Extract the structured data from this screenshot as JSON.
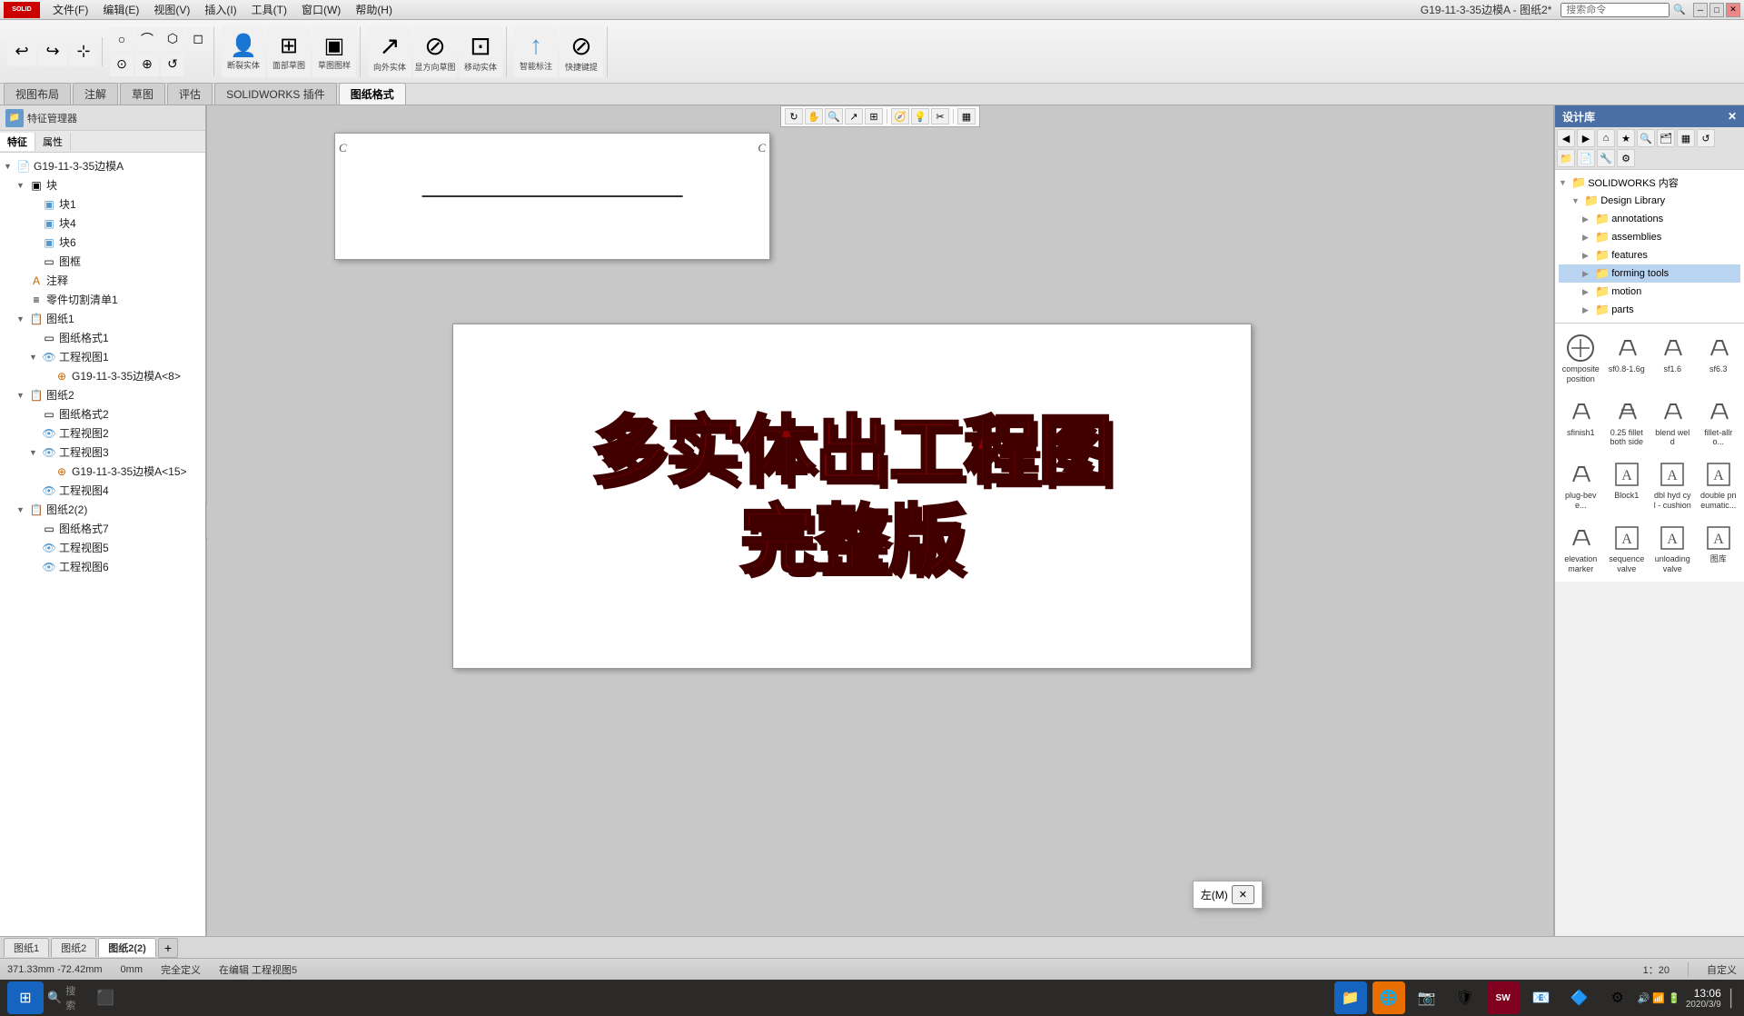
{
  "app": {
    "title": "G19-11-3-35边模A - 图纸2*",
    "logo_text": "SW"
  },
  "menubar": {
    "items": [
      "文件(F)",
      "编辑(E)",
      "视图(V)",
      "插入(I)",
      "工具(T)",
      "窗口(W)",
      "帮助(H)"
    ],
    "search_placeholder": "搜索命令"
  },
  "toolbar": {
    "groups": [
      {
        "buttons": [
          "↩",
          "↪",
          "⊕"
        ]
      },
      {
        "buttons": [
          "○",
          "⊙",
          "⌒",
          "◇",
          "○",
          "⊙",
          "↺"
        ]
      },
      {
        "large_buttons": [
          {
            "icon": "👤",
            "label": "断裂实体"
          },
          {
            "icon": "⬡",
            "label": "面部草图"
          },
          {
            "icon": "▣",
            "label": "草图图样"
          }
        ]
      },
      {
        "large_buttons": [
          {
            "icon": "↗",
            "label": "向外实体"
          },
          {
            "icon": "⊞",
            "label": "显方向草图"
          },
          {
            "icon": "⊡",
            "label": "移动实体"
          }
        ]
      },
      {
        "large_buttons": [
          {
            "icon": "⬆",
            "label": "智能标注"
          },
          {
            "icon": "⊘",
            "label": "快捷键提"
          }
        ]
      }
    ]
  },
  "tabs": {
    "items": [
      "视图布局",
      "注解",
      "草图",
      "评估",
      "SOLIDWORKS 插件",
      "图纸格式"
    ]
  },
  "left_panel": {
    "title": "G19-11-3-35边模A",
    "tree": [
      {
        "id": "root",
        "label": "G19-11-3-35边模A",
        "level": 0,
        "expanded": true,
        "icon": "📄"
      },
      {
        "id": "block",
        "label": "块",
        "level": 1,
        "expanded": true,
        "icon": "▣"
      },
      {
        "id": "block1",
        "label": "块1",
        "level": 2,
        "icon": "▣"
      },
      {
        "id": "block4",
        "label": "块4",
        "level": 2,
        "icon": "▣"
      },
      {
        "id": "block6",
        "label": "块6",
        "level": 2,
        "icon": "▣"
      },
      {
        "id": "frame",
        "label": "图框",
        "level": 2,
        "icon": "▭"
      },
      {
        "id": "note",
        "label": "注释",
        "level": 1,
        "icon": "A"
      },
      {
        "id": "bom",
        "label": "零件切割清单1",
        "level": 1,
        "icon": "≡"
      },
      {
        "id": "sheet1",
        "label": "图纸1",
        "level": 1,
        "expanded": true,
        "icon": "📋"
      },
      {
        "id": "view-style1",
        "label": "图纸格式1",
        "level": 2,
        "icon": "▭"
      },
      {
        "id": "view1",
        "label": "工程视图1",
        "level": 2,
        "expanded": true,
        "icon": "👁"
      },
      {
        "id": "view1-ref",
        "label": "G19-11-3-35边模A<8>",
        "level": 3,
        "icon": "⊕"
      },
      {
        "id": "sheet2",
        "label": "图纸2",
        "level": 1,
        "expanded": true,
        "icon": "📋"
      },
      {
        "id": "view-style2",
        "label": "图纸格式2",
        "level": 2,
        "icon": "▭"
      },
      {
        "id": "view2",
        "label": "工程视图2",
        "level": 2,
        "icon": "👁"
      },
      {
        "id": "view3",
        "label": "工程视图3",
        "level": 2,
        "expanded": true,
        "icon": "👁"
      },
      {
        "id": "view3-ref",
        "label": "G19-11-3-35边模A<15>",
        "level": 3,
        "icon": "⊕"
      },
      {
        "id": "view4",
        "label": "工程视图4",
        "level": 2,
        "icon": "👁"
      },
      {
        "id": "sheet2b",
        "label": "图纸2(2)",
        "level": 1,
        "expanded": true,
        "icon": "📋"
      },
      {
        "id": "view-style7",
        "label": "图纸格式7",
        "level": 2,
        "icon": "▭"
      },
      {
        "id": "view5",
        "label": "工程视图5",
        "level": 2,
        "icon": "👁"
      },
      {
        "id": "view6",
        "label": "工程视图6",
        "level": 2,
        "icon": "👁"
      }
    ]
  },
  "drawing_area": {
    "main_text_line1": "多实体出工程图",
    "main_text_line2": "完整版",
    "corner_marks": [
      "C",
      "C"
    ]
  },
  "right_panel": {
    "title": "设计库",
    "nav_buttons": [
      "◀",
      "▶",
      "⌂",
      "★",
      "🔍",
      "🖹",
      "▦",
      "↺"
    ],
    "tree": [
      {
        "id": "sw-content",
        "label": "SOLIDWORKS 内容",
        "level": 0,
        "expanded": true,
        "icon": "folder"
      },
      {
        "id": "design-lib",
        "label": "Design Library",
        "level": 1,
        "expanded": true,
        "icon": "folder"
      },
      {
        "id": "annotations",
        "label": "annotations",
        "level": 2,
        "expanded": false,
        "icon": "folder"
      },
      {
        "id": "assemblies",
        "label": "assemblies",
        "level": 2,
        "expanded": false,
        "icon": "folder"
      },
      {
        "id": "features",
        "label": "features",
        "level": 2,
        "expanded": false,
        "icon": "folder"
      },
      {
        "id": "forming-tools",
        "label": "forming tools",
        "level": 2,
        "expanded": false,
        "icon": "folder",
        "selected": true
      },
      {
        "id": "motion",
        "label": "motion",
        "level": 2,
        "expanded": false,
        "icon": "folder"
      },
      {
        "id": "parts",
        "label": "parts",
        "level": 2,
        "expanded": false,
        "icon": "folder"
      }
    ],
    "grid_items": [
      {
        "id": "composite-pos",
        "label": "composite position",
        "shape": "check_mark"
      },
      {
        "id": "sf08",
        "label": "sf0.8-1.6g",
        "shape": "check_mark"
      },
      {
        "id": "sf16",
        "label": "sf1.6",
        "shape": "check_mark"
      },
      {
        "id": "sf63",
        "label": "sf6.3",
        "shape": "check_mark"
      },
      {
        "id": "sfinish1",
        "label": "sfinish1",
        "shape": "check_mark"
      },
      {
        "id": "025fillet",
        "label": "0.25 fillet both side",
        "shape": "fillet"
      },
      {
        "id": "blend-weld",
        "label": "blend weld",
        "shape": "weld"
      },
      {
        "id": "fillet-allround",
        "label": "fillet-allro...",
        "shape": "fillet2"
      },
      {
        "id": "plug-bevel",
        "label": "plug-beve...",
        "shape": "plug"
      },
      {
        "id": "block1",
        "label": "Block1",
        "shape": "text_a"
      },
      {
        "id": "dbl-hyd",
        "label": "dbl hyd cyl - cushion",
        "shape": "text_a"
      },
      {
        "id": "double-pneum",
        "label": "double pneumatic...",
        "shape": "text_a"
      },
      {
        "id": "elev-marker",
        "label": "elevation marker",
        "shape": "check_mark"
      },
      {
        "id": "seq-valve",
        "label": "sequence valve",
        "shape": "text_a"
      },
      {
        "id": "unloading-valve",
        "label": "unloading valve",
        "shape": "text_a"
      },
      {
        "id": "last-item",
        "label": "图库",
        "shape": "text_a"
      }
    ]
  },
  "statusbar": {
    "coords": "371.33mm    -72.42mm",
    "z_coord": "0mm",
    "status": "完全定义",
    "editing": "在编辑 工程视图5",
    "scale": "1：20",
    "setting": "自定义",
    "zoom": "▪"
  },
  "sheet_tabs": {
    "items": [
      "图纸1",
      "图纸2",
      "图纸2(2)"
    ],
    "active": "图纸2(2)"
  },
  "taskbar": {
    "start_icon": "⊞",
    "search_icon": "🔍",
    "search_text": "搜索",
    "apps": [
      "📁",
      "🌐",
      "📷",
      "🛡",
      "📧",
      "🔷",
      "⚙"
    ],
    "system_time": "13:06",
    "system_date": "2020/3/9"
  },
  "popup": {
    "text": "左(M)"
  }
}
